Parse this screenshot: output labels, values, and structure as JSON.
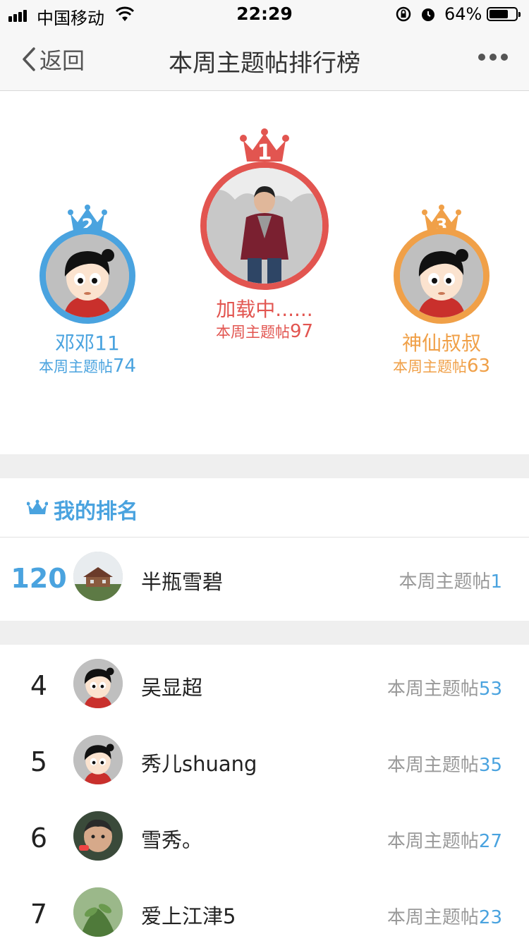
{
  "status_bar": {
    "carrier": "中国移动",
    "time": "22:29",
    "battery": "64%"
  },
  "nav": {
    "back_label": "返回",
    "title": "本周主题帖排行榜"
  },
  "podium": {
    "first": {
      "rank": "1",
      "name": "加载中......",
      "label": "本周主题帖",
      "count": "97",
      "color": "#e25550"
    },
    "second": {
      "rank": "2",
      "name": "邓邓11",
      "label": "本周主题帖",
      "count": "74",
      "color": "#4aa3df"
    },
    "third": {
      "rank": "3",
      "name": "神仙叔叔",
      "label": "本周主题帖",
      "count": "63",
      "color": "#f0a048"
    }
  },
  "my_rank": {
    "heading": "我的排名",
    "rank": "120",
    "name": "半瓶雪碧",
    "label": "本周主题帖",
    "count": "1"
  },
  "list": [
    {
      "rank": "4",
      "name": "吴显超",
      "label": "本周主题帖",
      "count": "53"
    },
    {
      "rank": "5",
      "name": "秀儿shuang",
      "label": "本周主题帖",
      "count": "35"
    },
    {
      "rank": "6",
      "name": "雪秀。",
      "label": "本周主题帖",
      "count": "27"
    },
    {
      "rank": "7",
      "name": "爱上江津5",
      "label": "本周主题帖",
      "count": "23"
    }
  ],
  "colors": {
    "accent_blue": "#4aa3df",
    "first_red": "#e25550",
    "third_orange": "#f0a048"
  }
}
